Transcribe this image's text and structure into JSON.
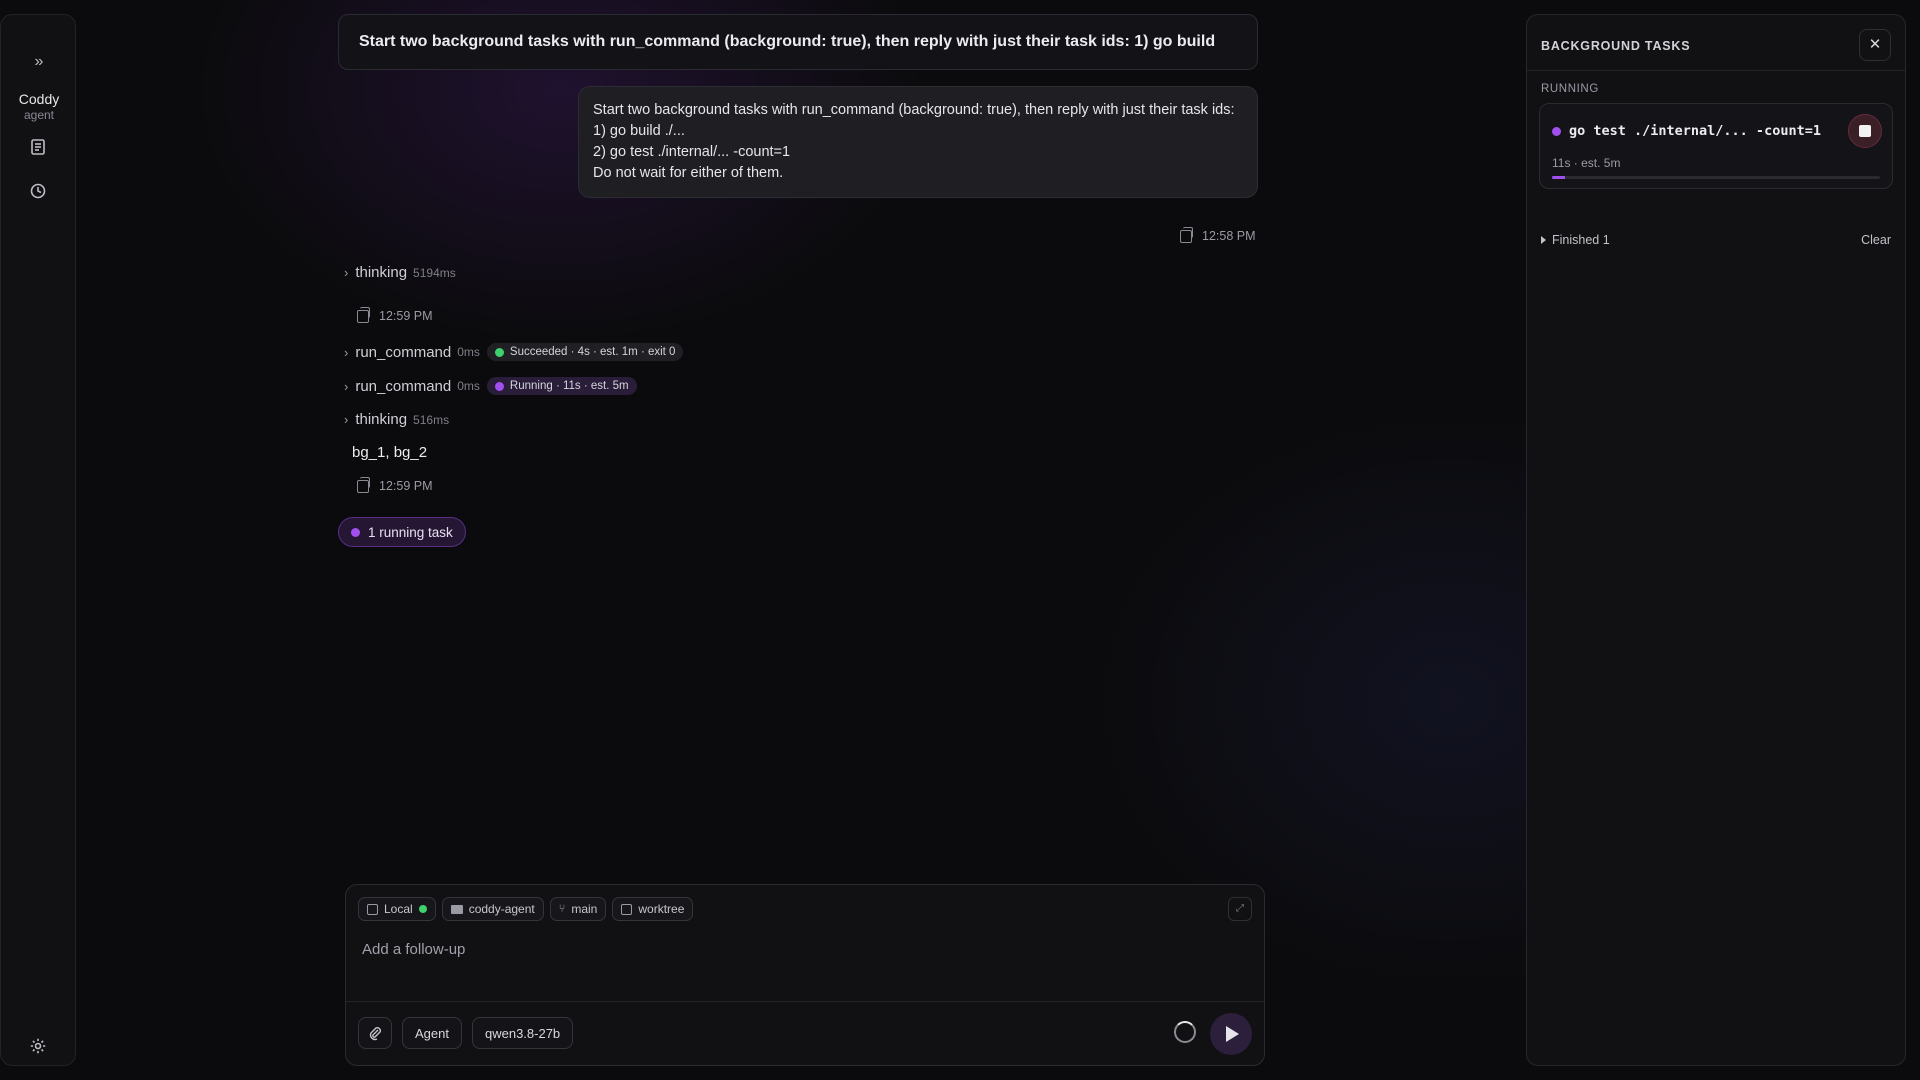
{
  "app": {
    "name": "Coddy",
    "subtitle": "agent"
  },
  "prompt_bar": {
    "text": "Start two background tasks with run_command (background: true), then reply with just their task ids: 1) go build"
  },
  "user_message": {
    "lines": [
      "Start two background tasks with run_command (background: true), then reply with just their task ids:",
      "1) go build ./...",
      "2) go test ./internal/... -count=1",
      "Do not wait for either of them."
    ],
    "time": "12:58 PM"
  },
  "steps": [
    {
      "label": "thinking",
      "duration": "5194ms"
    },
    {
      "label": "run_command",
      "duration": "0ms",
      "status": "Succeeded · 4s · est. 1m · exit 0",
      "status_color": "#3ed26e"
    },
    {
      "label": "run_command",
      "duration": "0ms",
      "status": "Running · 11s · est. 5m",
      "status_color": "#a24ff0"
    },
    {
      "label": "thinking",
      "duration": "516ms"
    }
  ],
  "assistant": {
    "time_1": "12:59 PM",
    "answer": "bg_1, bg_2",
    "time_2": "12:59 PM"
  },
  "running_chip": {
    "label": "1 running task"
  },
  "composer": {
    "chips": {
      "local": "Local",
      "folder": "coddy-agent",
      "branch": "main",
      "worktree": "worktree"
    },
    "placeholder": "Add a follow-up",
    "mode": "Agent",
    "model": "qwen3.8-27b"
  },
  "panel": {
    "title": "BACKGROUND TASKS",
    "section": "RUNNING",
    "task": {
      "command": "go test ./internal/... -count=1",
      "time": "11s · est. 5m",
      "progress": 0.04
    },
    "finished": "Finished 1",
    "clear": "Clear"
  },
  "colors": {
    "accent": "#a24ff0",
    "success": "#3ed26e"
  }
}
